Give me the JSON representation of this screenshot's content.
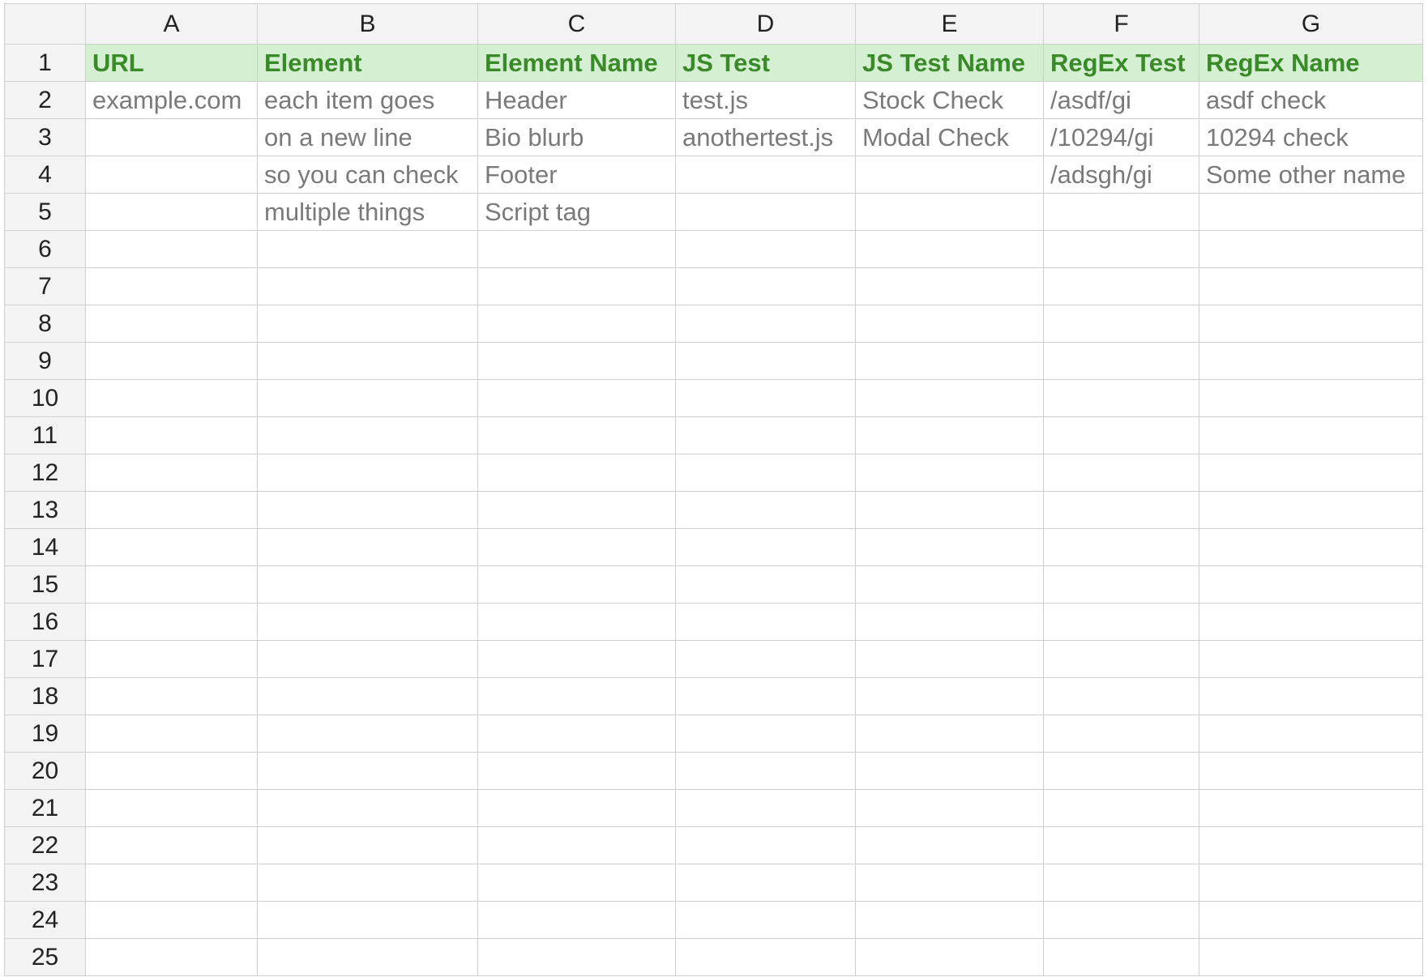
{
  "columns": [
    "A",
    "B",
    "C",
    "D",
    "E",
    "F",
    "G"
  ],
  "row_numbers": [
    "1",
    "2",
    "3",
    "4",
    "5",
    "6",
    "7",
    "8",
    "9",
    "10",
    "11",
    "12",
    "13",
    "14",
    "15",
    "16",
    "17",
    "18",
    "19",
    "20",
    "21",
    "22",
    "23",
    "24",
    "25"
  ],
  "rows": [
    [
      "URL",
      "Element",
      "Element Name",
      "JS Test",
      "JS Test Name",
      "RegEx Test",
      "RegEx Name"
    ],
    [
      "example.com",
      "each item goes",
      "Header",
      "test.js",
      "Stock Check",
      "/asdf/gi",
      "asdf check"
    ],
    [
      "",
      "on a new line",
      "Bio blurb",
      "anothertest.js",
      "Modal Check",
      "/10294/gi",
      "10294 check"
    ],
    [
      "",
      "so you can check",
      "Footer",
      "",
      "",
      "/adsgh/gi",
      "Some other name"
    ],
    [
      "",
      "multiple things",
      "Script tag",
      "",
      "",
      "",
      ""
    ]
  ],
  "colors": {
    "header_row_fill": "#d5efd3",
    "header_row_text": "#3a8a2a",
    "cell_text": "#7a7a7a",
    "gridline": "#cfcfcf",
    "heading_fill": "#f3f3f3"
  }
}
